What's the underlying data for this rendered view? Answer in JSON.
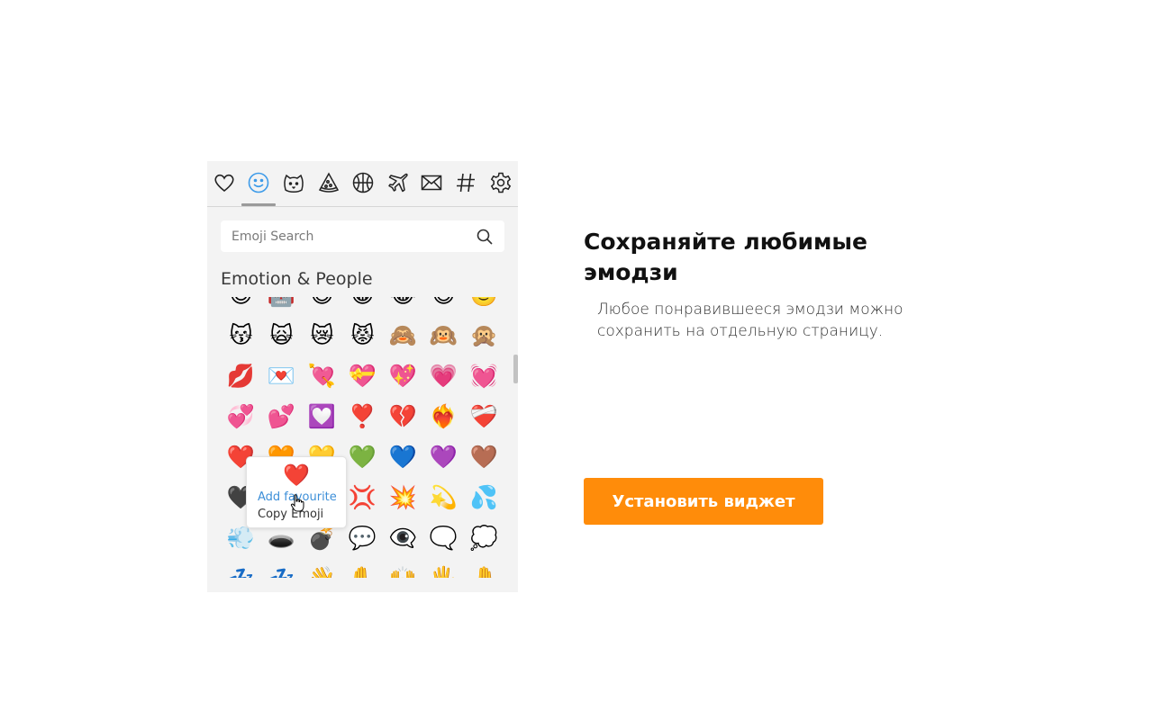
{
  "tabs": [
    {
      "icon": "heart-outline-icon",
      "active": false
    },
    {
      "icon": "smiley-icon",
      "active": true
    },
    {
      "icon": "cat-face-icon",
      "active": false
    },
    {
      "icon": "pizza-slice-icon",
      "active": false
    },
    {
      "icon": "basketball-icon",
      "active": false
    },
    {
      "icon": "airplane-icon",
      "active": false
    },
    {
      "icon": "envelope-icon",
      "active": false
    },
    {
      "icon": "hashtag-icon",
      "active": false
    },
    {
      "icon": "gear-icon",
      "active": false
    }
  ],
  "colors": {
    "accent": "#ff8c0a",
    "active_tab": "#3d9be9",
    "link": "#3d8fd8",
    "panel_bg": "#f3f3f3"
  },
  "search": {
    "placeholder": "Emoji Search",
    "value": ""
  },
  "section_title": "Emotion & People",
  "emoji_grid": [
    "😈",
    "🤖",
    "😃",
    "😀",
    "😂",
    "😄",
    "🙂",
    "😽",
    "🙀",
    "😿",
    "😾",
    "🙈",
    "🙉",
    "🙊",
    "💋",
    "💌",
    "💘",
    "💝",
    "💖",
    "💗",
    "💓",
    "💞",
    "💕",
    "💟",
    "❣️",
    "💔",
    "❤️‍🔥",
    "❤️‍🩹",
    "❤️",
    "🧡",
    "💛",
    "💚",
    "💙",
    "💜",
    "🤎",
    "🖤",
    "🤍",
    "💯",
    "💢",
    "💥",
    "💫",
    "💦",
    "💨",
    "🕳️",
    "💣",
    "💬",
    "👁️‍🗨️",
    "🗨️",
    "💭",
    "💤",
    "💤",
    "👋",
    "✋",
    "🙌",
    "🖐️",
    "🤚"
  ],
  "tooltip": {
    "emoji": "❤️",
    "add_favourite": "Add favourite",
    "copy_emoji": "Copy Emoji"
  },
  "promo": {
    "headline": "Сохраняйте любимые эмодзи",
    "description": "Любое понравившееся эмодзи можно сохранить на отдельную страницу.",
    "button_label": "Установить виджет"
  }
}
